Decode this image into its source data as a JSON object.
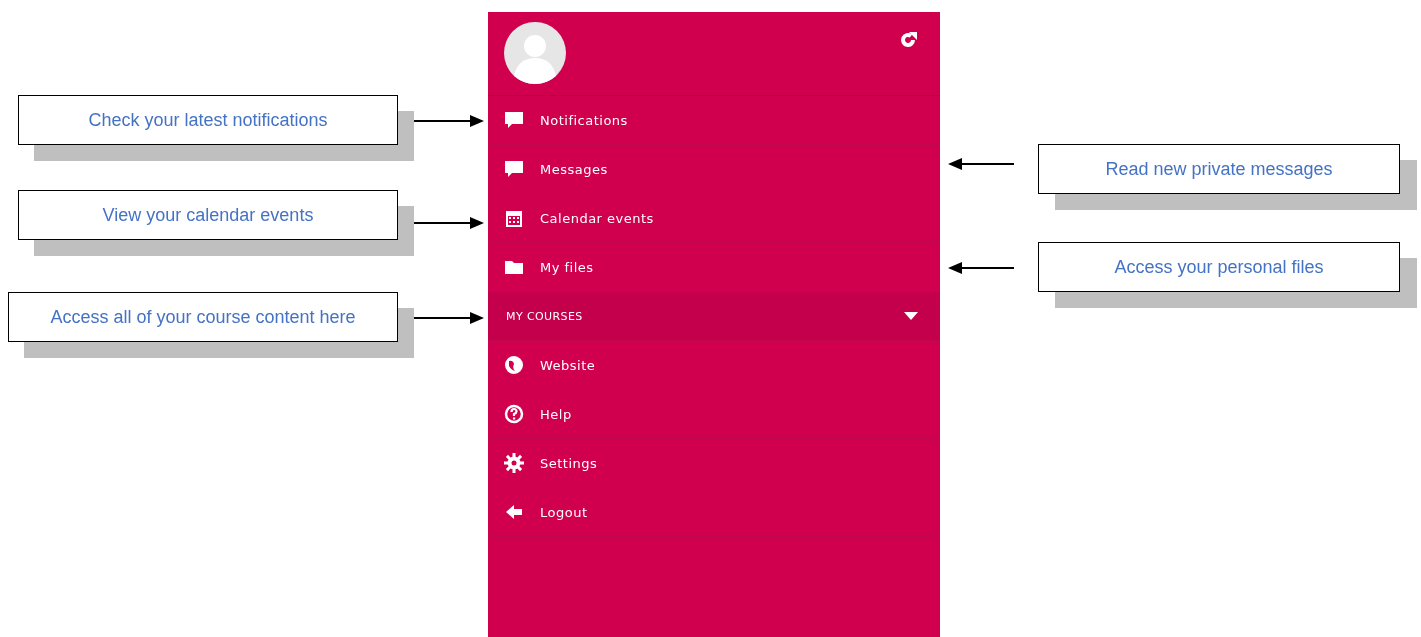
{
  "menu": {
    "items": [
      {
        "kind": "link",
        "label": "Notifications"
      },
      {
        "kind": "link",
        "label": "Messages"
      },
      {
        "kind": "link",
        "label": "Calendar events"
      },
      {
        "kind": "link",
        "label": "My files"
      },
      {
        "kind": "section",
        "label": "MY COURSES"
      },
      {
        "kind": "link",
        "label": "Website"
      },
      {
        "kind": "link",
        "label": "Help"
      },
      {
        "kind": "link",
        "label": "Settings"
      },
      {
        "kind": "link",
        "label": "Logout"
      }
    ]
  },
  "callouts": {
    "left": [
      "Check your latest notifications",
      "View your calendar events",
      "Access all of your course content here"
    ],
    "right": [
      "Read new private messages",
      "Access your personal files"
    ]
  }
}
